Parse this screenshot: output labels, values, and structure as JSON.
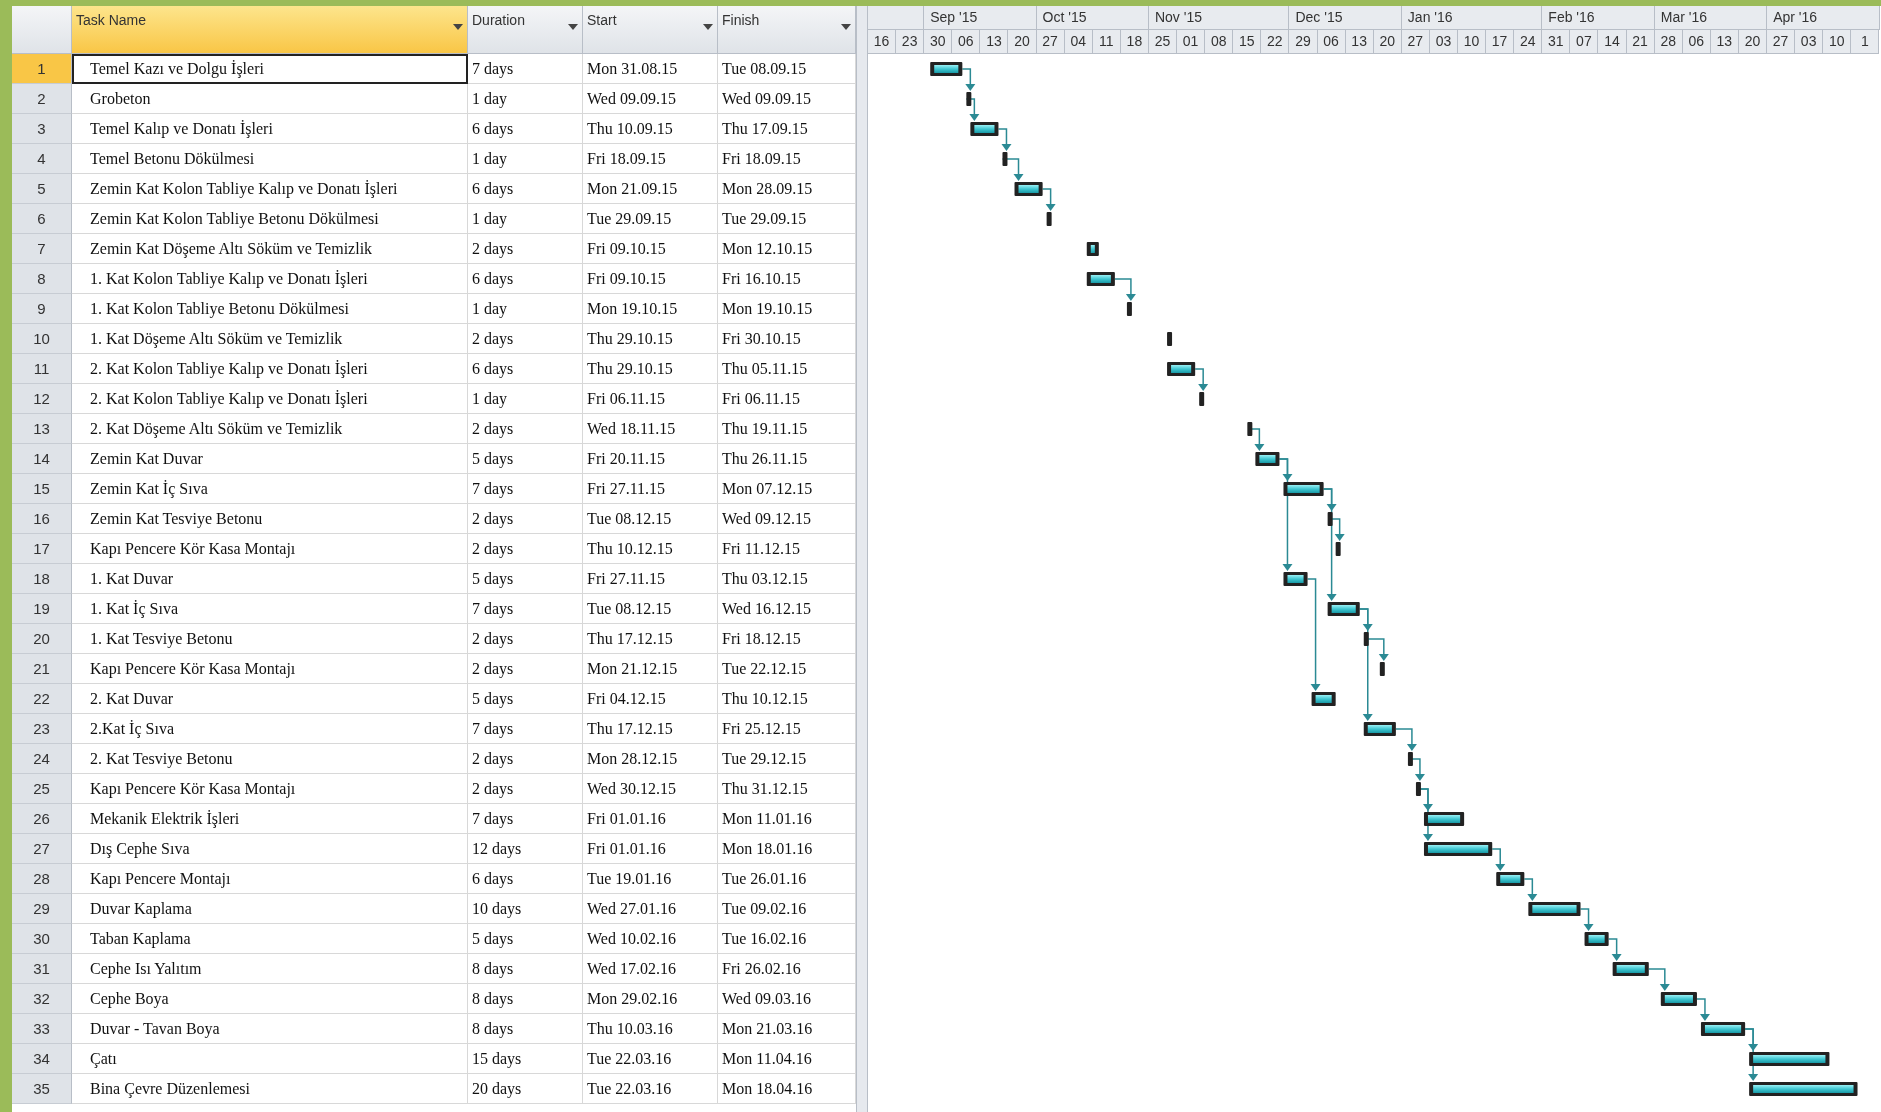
{
  "columns": [
    {
      "label": "Task Name",
      "selected": true
    },
    {
      "label": "Duration",
      "selected": false
    },
    {
      "label": "Start",
      "selected": false
    },
    {
      "label": "Finish",
      "selected": false
    }
  ],
  "timeline": [
    {
      "day": "16"
    },
    {
      "day": "23"
    },
    {
      "day": "30",
      "month": "Sep '15"
    },
    {
      "day": "06"
    },
    {
      "day": "13"
    },
    {
      "day": "20"
    },
    {
      "day": "27",
      "month": "Oct '15"
    },
    {
      "day": "04"
    },
    {
      "day": "11"
    },
    {
      "day": "18"
    },
    {
      "day": "25",
      "month": "Nov '15"
    },
    {
      "day": "01"
    },
    {
      "day": "08"
    },
    {
      "day": "15"
    },
    {
      "day": "22"
    },
    {
      "day": "29",
      "month": "Dec '15"
    },
    {
      "day": "06"
    },
    {
      "day": "13"
    },
    {
      "day": "20"
    },
    {
      "day": "27",
      "month": "Jan '16"
    },
    {
      "day": "03"
    },
    {
      "day": "10"
    },
    {
      "day": "17"
    },
    {
      "day": "24"
    },
    {
      "day": "31",
      "month": "Feb '16"
    },
    {
      "day": "07"
    },
    {
      "day": "14"
    },
    {
      "day": "21"
    },
    {
      "day": "28",
      "month": "Mar '16"
    },
    {
      "day": "06"
    },
    {
      "day": "13"
    },
    {
      "day": "20"
    },
    {
      "day": "27",
      "month": "Apr '16"
    },
    {
      "day": "03"
    },
    {
      "day": "10"
    },
    {
      "day": "1"
    }
  ],
  "rows": [
    {
      "id": "1",
      "name": "Temel Kazı ve Dolgu İşleri",
      "duration": "7 days",
      "start": "Mon 31.08.15",
      "finish": "Tue 08.09.15",
      "selected": true
    },
    {
      "id": "2",
      "name": "Grobeton",
      "duration": "1 day",
      "start": "Wed 09.09.15",
      "finish": "Wed 09.09.15",
      "selected": false
    },
    {
      "id": "3",
      "name": "Temel Kalıp ve Donatı İşleri",
      "duration": "6 days",
      "start": "Thu 10.09.15",
      "finish": "Thu 17.09.15",
      "selected": false
    },
    {
      "id": "4",
      "name": "Temel Betonu Dökülmesi",
      "duration": "1 day",
      "start": "Fri 18.09.15",
      "finish": "Fri 18.09.15",
      "selected": false
    },
    {
      "id": "5",
      "name": "Zemin Kat Kolon Tabliye Kalıp ve Donatı İşleri",
      "duration": "6 days",
      "start": "Mon 21.09.15",
      "finish": "Mon 28.09.15",
      "selected": false
    },
    {
      "id": "6",
      "name": "Zemin Kat Kolon Tabliye Betonu Dökülmesi",
      "duration": "1 day",
      "start": "Tue 29.09.15",
      "finish": "Tue 29.09.15",
      "selected": false
    },
    {
      "id": "7",
      "name": "Zemin Kat Döşeme Altı Söküm ve Temizlik",
      "duration": "2 days",
      "start": "Fri 09.10.15",
      "finish": "Mon 12.10.15",
      "selected": false
    },
    {
      "id": "8",
      "name": "1. Kat Kolon Tabliye Kalıp ve Donatı İşleri",
      "duration": "6 days",
      "start": "Fri 09.10.15",
      "finish": "Fri 16.10.15",
      "selected": false
    },
    {
      "id": "9",
      "name": "1. Kat Kolon Tabliye Betonu Dökülmesi",
      "duration": "1 day",
      "start": "Mon 19.10.15",
      "finish": "Mon 19.10.15",
      "selected": false
    },
    {
      "id": "10",
      "name": "1. Kat Döşeme Altı Söküm ve Temizlik",
      "duration": "2 days",
      "start": "Thu 29.10.15",
      "finish": "Fri 30.10.15",
      "selected": false
    },
    {
      "id": "11",
      "name": "2. Kat Kolon Tabliye Kalıp ve Donatı İşleri",
      "duration": "6 days",
      "start": "Thu 29.10.15",
      "finish": "Thu 05.11.15",
      "selected": false
    },
    {
      "id": "12",
      "name": "2. Kat Kolon Tabliye Kalıp ve Donatı İşleri",
      "duration": "1 day",
      "start": "Fri 06.11.15",
      "finish": "Fri 06.11.15",
      "selected": false
    },
    {
      "id": "13",
      "name": "2. Kat Döşeme Altı Söküm ve Temizlik",
      "duration": "2 days",
      "start": "Wed 18.11.15",
      "finish": "Thu 19.11.15",
      "selected": false
    },
    {
      "id": "14",
      "name": "Zemin Kat Duvar",
      "duration": "5 days",
      "start": "Fri 20.11.15",
      "finish": "Thu 26.11.15",
      "selected": false
    },
    {
      "id": "15",
      "name": "Zemin Kat İç Sıva",
      "duration": "7 days",
      "start": "Fri 27.11.15",
      "finish": "Mon 07.12.15",
      "selected": false
    },
    {
      "id": "16",
      "name": "Zemin Kat Tesviye Betonu",
      "duration": "2 days",
      "start": "Tue 08.12.15",
      "finish": "Wed 09.12.15",
      "selected": false
    },
    {
      "id": "17",
      "name": "Kapı Pencere Kör Kasa Montajı",
      "duration": "2 days",
      "start": "Thu 10.12.15",
      "finish": "Fri 11.12.15",
      "selected": false
    },
    {
      "id": "18",
      "name": "1. Kat Duvar",
      "duration": "5 days",
      "start": "Fri 27.11.15",
      "finish": "Thu 03.12.15",
      "selected": false
    },
    {
      "id": "19",
      "name": "1. Kat İç Sıva",
      "duration": "7 days",
      "start": "Tue 08.12.15",
      "finish": "Wed 16.12.15",
      "selected": false
    },
    {
      "id": "20",
      "name": "1. Kat Tesviye Betonu",
      "duration": "2 days",
      "start": "Thu 17.12.15",
      "finish": "Fri 18.12.15",
      "selected": false
    },
    {
      "id": "21",
      "name": "Kapı Pencere Kör Kasa Montajı",
      "duration": "2 days",
      "start": "Mon 21.12.15",
      "finish": "Tue 22.12.15",
      "selected": false
    },
    {
      "id": "22",
      "name": "2. Kat Duvar",
      "duration": "5 days",
      "start": "Fri 04.12.15",
      "finish": "Thu 10.12.15",
      "selected": false
    },
    {
      "id": "23",
      "name": "2.Kat İç Sıva",
      "duration": "7 days",
      "start": "Thu 17.12.15",
      "finish": "Fri 25.12.15",
      "selected": false
    },
    {
      "id": "24",
      "name": "2. Kat Tesviye Betonu",
      "duration": "2 days",
      "start": "Mon 28.12.15",
      "finish": "Tue 29.12.15",
      "selected": false
    },
    {
      "id": "25",
      "name": "Kapı Pencere Kör Kasa Montajı",
      "duration": "2 days",
      "start": "Wed 30.12.15",
      "finish": "Thu 31.12.15",
      "selected": false
    },
    {
      "id": "26",
      "name": "Mekanik Elektrik İşleri",
      "duration": "7 days",
      "start": "Fri 01.01.16",
      "finish": "Mon 11.01.16",
      "selected": false
    },
    {
      "id": "27",
      "name": "Dış Cephe Sıva",
      "duration": "12 days",
      "start": "Fri 01.01.16",
      "finish": "Mon 18.01.16",
      "selected": false
    },
    {
      "id": "28",
      "name": "Kapı Pencere Montajı",
      "duration": "6 days",
      "start": "Tue 19.01.16",
      "finish": "Tue 26.01.16",
      "selected": false
    },
    {
      "id": "29",
      "name": "Duvar Kaplama",
      "duration": "10 days",
      "start": "Wed 27.01.16",
      "finish": "Tue 09.02.16",
      "selected": false
    },
    {
      "id": "30",
      "name": "Taban Kaplama",
      "duration": "5 days",
      "start": "Wed 10.02.16",
      "finish": "Tue 16.02.16",
      "selected": false
    },
    {
      "id": "31",
      "name": "Cephe Isı Yalıtım",
      "duration": "8 days",
      "start": "Wed 17.02.16",
      "finish": "Fri 26.02.16",
      "selected": false
    },
    {
      "id": "32",
      "name": "Cephe Boya",
      "duration": "8 days",
      "start": "Mon 29.02.16",
      "finish": "Wed 09.03.16",
      "selected": false
    },
    {
      "id": "33",
      "name": "Duvar - Tavan Boya",
      "duration": "8 days",
      "start": "Thu 10.03.16",
      "finish": "Mon 21.03.16",
      "selected": false
    },
    {
      "id": "34",
      "name": "Çatı",
      "duration": "15 days",
      "start": "Tue 22.03.16",
      "finish": "Mon 11.04.16",
      "selected": false
    },
    {
      "id": "35",
      "name": "Bina Çevre Düzenlemesi",
      "duration": "20 days",
      "start": "Tue 22.03.16",
      "finish": "Mon 18.04.16",
      "selected": false
    }
  ]
}
